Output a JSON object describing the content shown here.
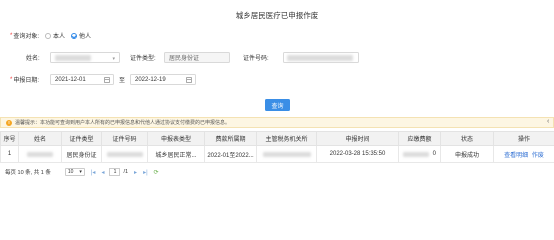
{
  "page": {
    "title": "城乡居民医疗已申报作废"
  },
  "form": {
    "query_target": {
      "label": "查询对象:",
      "options": [
        {
          "label": "本人",
          "checked": false
        },
        {
          "label": "他人",
          "checked": true
        }
      ]
    },
    "name": {
      "label": "姓名:",
      "value": ""
    },
    "id_type": {
      "label": "证件类型:",
      "value": "居民身份证"
    },
    "id_number": {
      "label": "证件号码:",
      "value": ""
    },
    "declare_date": {
      "label": "申报日期:",
      "start": "2021-12-01",
      "separator": "至",
      "end": "2022-12-19"
    },
    "query_button": "查询"
  },
  "notice": {
    "icon": "warning-icon",
    "text": "温馨提示：本功能可查询到用户本人所有的已申报信息和代他人通过协议支付缴费的已申报信息。"
  },
  "table": {
    "headers": [
      "序号",
      "姓名",
      "证件类型",
      "证件号码",
      "申报表类型",
      "费款所属期",
      "主管税务机关所",
      "申报时间",
      "应缴费额",
      "状态",
      "操作"
    ],
    "rows": [
      {
        "index": "1",
        "name": "",
        "id_type": "居民身份证",
        "id_number": "",
        "form_type": "城乡居民正常...",
        "period": "2022-01至2022...",
        "tax_office": "",
        "declare_time": "2022-03-28 15:35:50",
        "amount": "0",
        "status": "申报成功",
        "actions": [
          "查看明细",
          "作废"
        ]
      }
    ]
  },
  "pagination": {
    "summary": "每页 10 条, 共 1 条",
    "page_size": "10",
    "current_page": "1",
    "total_pages": "/1"
  }
}
